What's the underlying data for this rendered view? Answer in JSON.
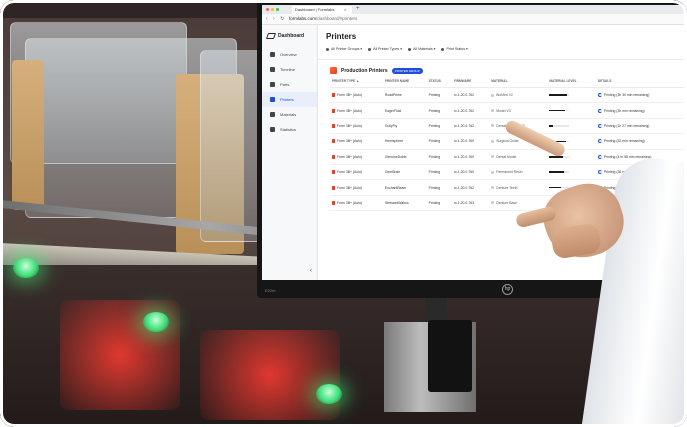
{
  "browser": {
    "tab_title": "Dashboard | Formlabs",
    "tab_close": "×",
    "new_tab": "+",
    "nav_glyphs": "‹ › ↻",
    "url_host": "formlabs.com",
    "url_path": "/dashboard/#printers"
  },
  "sidebar": {
    "brand": "Dashboard",
    "items": [
      {
        "label": "Overview",
        "icon": "home-icon"
      },
      {
        "label": "Timeline",
        "icon": "calendar-icon"
      },
      {
        "label": "Parts",
        "icon": "cube-icon"
      },
      {
        "label": "Printers",
        "icon": "printer-icon",
        "active": true
      },
      {
        "label": "Materials",
        "icon": "droplet-icon"
      },
      {
        "label": "Statistics",
        "icon": "chart-icon"
      }
    ],
    "collapse_glyph": "‹"
  },
  "main": {
    "title": "Printers",
    "filters": [
      "All Printer Groups ▾",
      "All Printer Types ▾",
      "All Materials ▾",
      "Print Status ▾"
    ],
    "section_title": "Production Printers",
    "section_badge": "PRINTER GROUP",
    "columns": [
      "PRINTER TYPE ▲",
      "PRINTER NAME",
      "STATUS",
      "FIRMWARE",
      "MATERIAL",
      "MATERIAL LEVEL",
      "DETAILS"
    ],
    "rows": [
      {
        "type": "Form 3B+ (Auto)",
        "name": "RoadPrime",
        "status": "Printing",
        "firmware": "rc-1.20.0-762",
        "material": "BioMed V2",
        "level": 0.9,
        "details": "Printing (3h 30 min remaining)"
      },
      {
        "type": "Form 3B+ (Auto)",
        "name": "EagerFluid",
        "status": "Printing",
        "firmware": "rc-1.20.0-762",
        "material": "Model V3",
        "level": 0.8,
        "details": "Printing (3h min remaining)"
      },
      {
        "type": "Form 3B+ (Auto)",
        "name": "GullyFly",
        "status": "Printing",
        "firmware": "rc-1.20.0-762",
        "material": "Dental LT Clear V2",
        "level": 0.2,
        "details": "Printing (1h 27 min remaining)"
      },
      {
        "type": "Form 3B+ (Auto)",
        "name": "Hemisphere",
        "status": "Printing",
        "firmware": "rc-1.20.0-760",
        "material": "Surgical Guide",
        "level": 0.85,
        "details": "Printing (52 min remaining)"
      },
      {
        "type": "Form 3B+ (Auto)",
        "name": "GenuineDoble",
        "status": "Printing",
        "firmware": "rc-1.20.0-760",
        "material": "Dental Model",
        "level": 0.7,
        "details": "Printing (4 hr 58 min remaining)"
      },
      {
        "type": "Form 3B+ (Auto)",
        "name": "GemBrain",
        "status": "Printing",
        "firmware": "rc-1.20.0-760",
        "material": "Permanent Resin",
        "level": 0.75,
        "details": "Printing (36 min remaining)"
      },
      {
        "type": "Form 3B+ (Auto)",
        "name": "EnchantBeam",
        "status": "Printing",
        "firmware": "rc-1.20.0-762",
        "material": "Denture Teeth",
        "level": 0.6,
        "details": "Printing (2h 37 min remaining)"
      },
      {
        "type": "Form 3B+ (Auto)",
        "name": "StressedWalrus",
        "status": "Printing",
        "firmware": "rc-1.20.0-763",
        "material": "Denture Base",
        "level": 0.8,
        "details": "Printing (2h 51 min rem...ing)"
      }
    ]
  },
  "monitor": {
    "model": "E22m",
    "logo": "hp"
  },
  "colors": {
    "accent": "#1f4fd6",
    "brand_orange": "#e0402a",
    "led_green": "#3fe07a"
  }
}
